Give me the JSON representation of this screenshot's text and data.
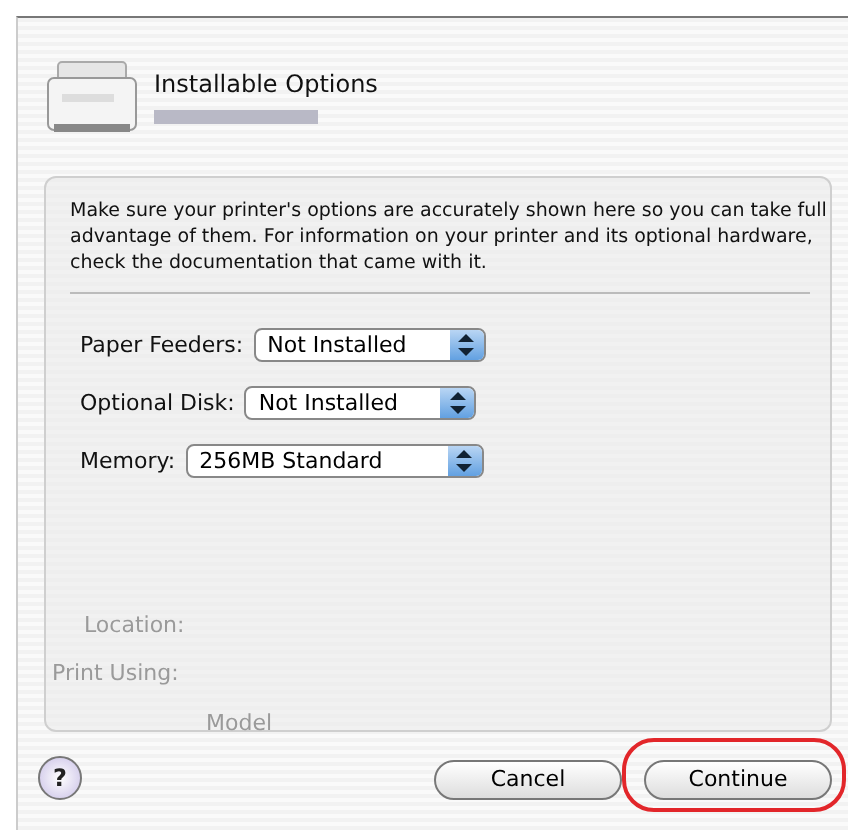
{
  "sheet": {
    "title": "Installable Options"
  },
  "message": "Make sure your printer's options are accurately shown here so you can take full advantage of them.  For information on your printer and its optional hardware, check the documentation that came with it.",
  "options": [
    {
      "label": "Paper Feeders:",
      "value": "Not Installed"
    },
    {
      "label": "Optional Disk:",
      "value": "Not Installed"
    },
    {
      "label": "Memory:",
      "value": "256MB Standard"
    }
  ],
  "background_labels": [
    "Location:",
    "Print Using:",
    "Model"
  ],
  "help_button": {
    "label": "?"
  },
  "buttons": [
    {
      "label": "Cancel",
      "highlighted": false
    },
    {
      "label": "Continue",
      "highlighted": true
    }
  ]
}
